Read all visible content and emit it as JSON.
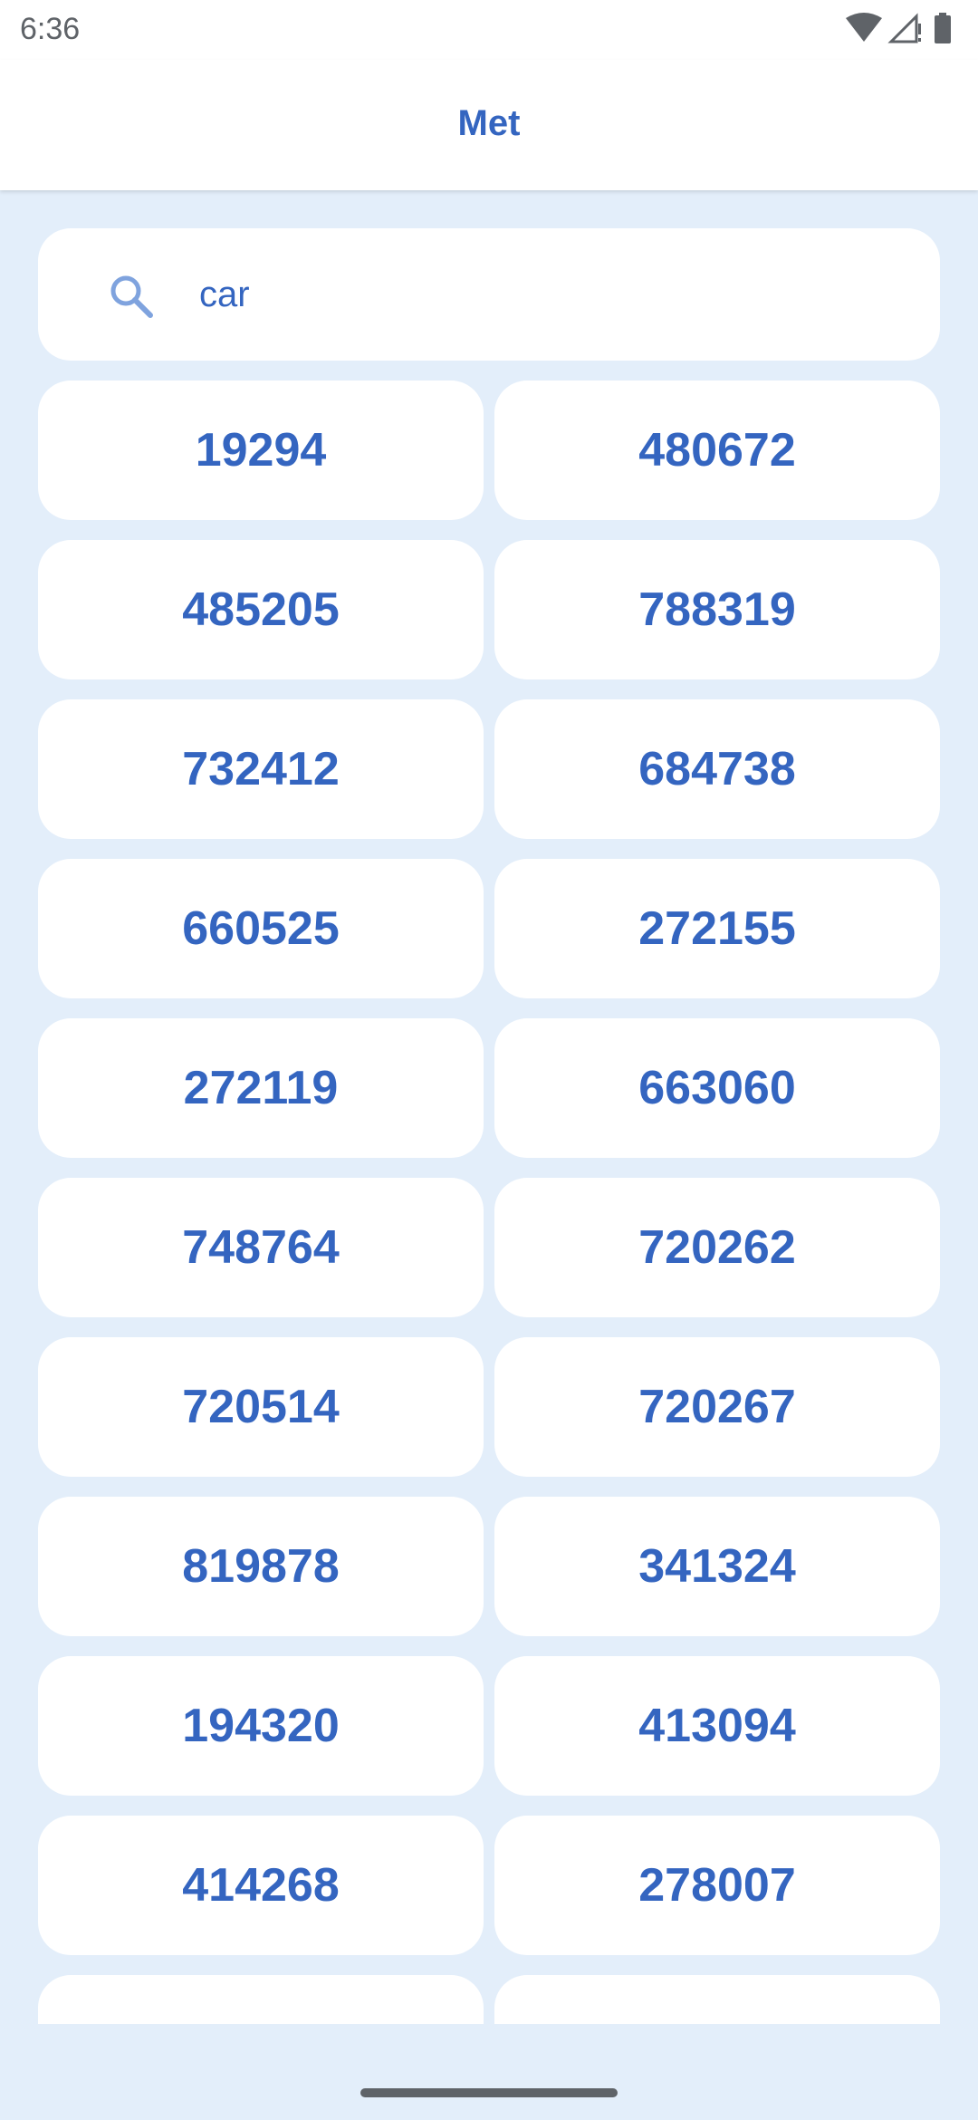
{
  "status_bar": {
    "time": "6:36",
    "icons": [
      "wifi-icon",
      "signal-icon",
      "battery-icon"
    ]
  },
  "app_bar": {
    "title": "Met"
  },
  "search": {
    "value": "car",
    "icon": "search-icon"
  },
  "results": [
    "19294",
    "480672",
    "485205",
    "788319",
    "732412",
    "684738",
    "660525",
    "272155",
    "272119",
    "663060",
    "748764",
    "720262",
    "720514",
    "720267",
    "819878",
    "341324",
    "194320",
    "413094",
    "414268",
    "278007",
    "",
    ""
  ],
  "colors": {
    "accent": "#3465C0",
    "background": "#E3EEFA",
    "surface": "#FFFFFF"
  }
}
